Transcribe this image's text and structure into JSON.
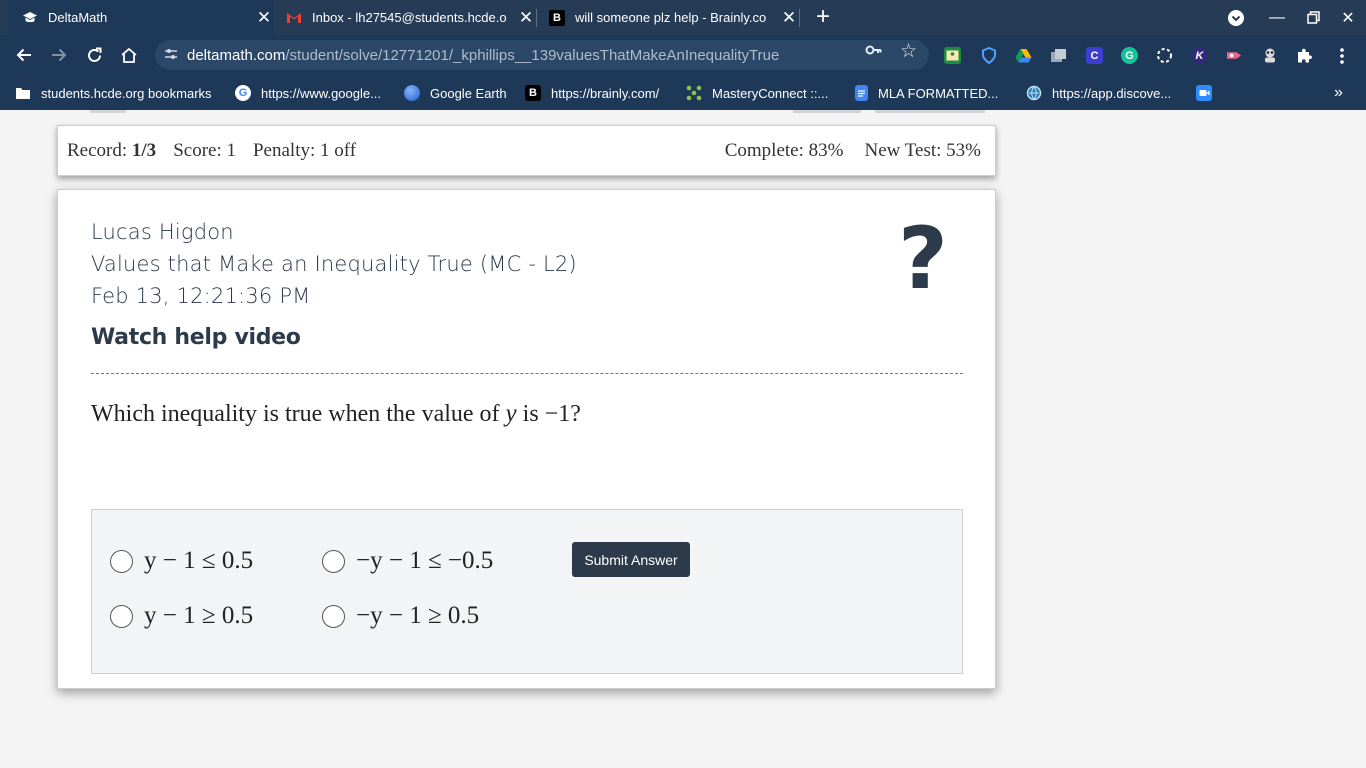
{
  "browser": {
    "tabs": [
      {
        "title": "DeltaMath",
        "favicon": "graduation-cap-icon"
      },
      {
        "title": "Inbox - lh27545@students.hcde.o",
        "favicon": "gmail-icon"
      },
      {
        "title": "will someone plz help - Brainly.co",
        "favicon": "brainly-icon"
      }
    ],
    "url_domain": "deltamath.com",
    "url_path": "/student/solve/12771201/_kphillips__139valuesThatMakeAnInequalityTrue",
    "bookmarks": [
      {
        "label": "students.hcde.org bookmarks",
        "icon": "folder-icon"
      },
      {
        "label": "https://www.google...",
        "icon": "google-icon"
      },
      {
        "label": "Google Earth",
        "icon": "google-earth-icon"
      },
      {
        "label": "https://brainly.com/",
        "icon": "brainly-icon"
      },
      {
        "label": "MasteryConnect ::...",
        "icon": "masteryconnect-icon"
      },
      {
        "label": "MLA FORMATTED...",
        "icon": "docs-icon"
      },
      {
        "label": "https://app.discove...",
        "icon": "discovery-icon"
      }
    ],
    "more_bookmarks": "»"
  },
  "record_bar": {
    "record_label": "Record:",
    "record_value": "1/3",
    "score": "Score: 1",
    "penalty": "Penalty: 1 off",
    "complete": "Complete: 83%",
    "new_test": "New Test: 53%"
  },
  "card": {
    "student_name": "Lucas Higdon",
    "assignment_title": "Values that Make an Inequality True (MC - L2)",
    "timestamp": "Feb 13, 12:21:36 PM",
    "help_link": "Watch help video",
    "help_icon": "?"
  },
  "question": {
    "prefix": "Which inequality is true when the value of ",
    "variable": "y",
    "middle": " is ",
    "value": "−1",
    "suffix": "?"
  },
  "choices": [
    "y − 1 ≤ 0.5",
    "−y − 1 ≤ −0.5",
    "y − 1 ≥ 0.5",
    "−y − 1 ≥ 0.5"
  ],
  "submit_label": "Submit Answer"
}
